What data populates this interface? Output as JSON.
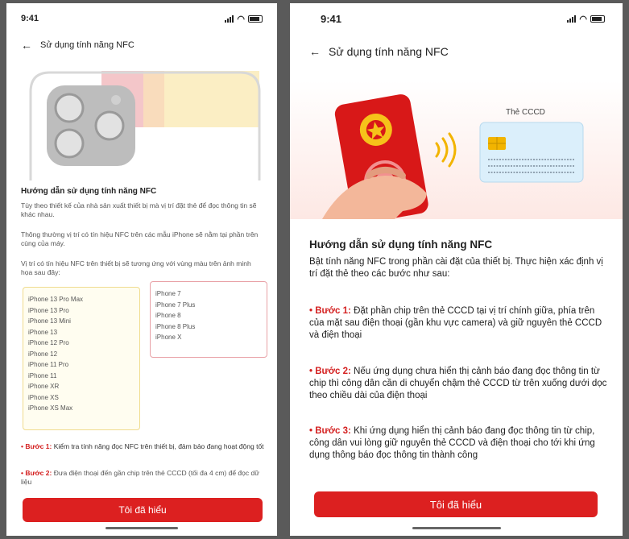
{
  "left": {
    "status_time": "9:41",
    "nav_title": "Sử dụng tính năng NFC",
    "heading": "Hướng dẫn sử dụng tính năng NFC",
    "para1": "Tùy theo thiết kế của nhà sản xuất thiết bị mà vị trí đặt thẻ để đọc thông tin sẽ khác nhau.",
    "para2": "Thông thường vị trí có tín hiệu NFC trên các mẫu iPhone sẽ nằm tại phần trên cùng của máy.",
    "para3": "Vị trí có tín hiệu NFC trên thiết bị sẽ tương ứng với vùng màu trên ảnh minh họa sau đây:",
    "models_yellow": [
      "iPhone 13 Pro Max",
      "iPhone 13 Pro",
      "iPhone 13 Mini",
      "iPhone 13",
      "iPhone 12 Pro",
      "iPhone 12",
      "iPhone 11 Pro",
      "iPhone 11",
      "iPhone XR",
      "iPhone XS",
      "iPhone XS Max"
    ],
    "models_pink": [
      "iPhone 7",
      "iPhone 7 Plus",
      "iPhone 8",
      "iPhone 8 Plus",
      "iPhone X"
    ],
    "step1_label": "• Bước 1:",
    "step1_text": "Kiểm tra tính năng đọc NFC trên thiết bị, đảm bảo đang hoạt động tốt",
    "step2_label": "• Bước 2:",
    "step2_text": "Đưa điện thoại đến gần chip trên thẻ CCCD (tối đa 4 cm) để đọc dữ liệu",
    "button": "Tôi đã hiểu"
  },
  "right": {
    "status_time": "9:41",
    "nav_title": "Sử dụng tính năng NFC",
    "card_label": "Thẻ CCCD",
    "heading": "Hướng dẫn sử dụng tính năng NFC",
    "intro": "Bật tính năng NFC trong phần cài đặt của thiết bị. Thực hiện xác định vị trí đặt thẻ theo các bước như sau:",
    "step1_label": "• Bước 1:",
    "step1_text": "Đặt phần chip trên thẻ CCCD tại vị trí chính giữa, phía trên của mặt sau điện thoại (gần khu vực camera) và giữ nguyên thẻ CCCD và điện thoại",
    "step2_label": "• Bước 2:",
    "step2_text": "Nếu ứng dụng chưa hiển thị cảnh báo đang đọc thông tin từ chip thì công dân cần di chuyển chậm thẻ CCCD từ trên xuống dưới dọc theo chiều dài của điện thoại",
    "step3_label": "• Bước 3:",
    "step3_text": "Khi ứng dụng hiển thị cảnh báo đang đọc thông tin từ chip, công dân vui lòng giữ nguyên thẻ CCCD và điện thoại cho tới khi ứng dụng thông báo đọc thông tin thành công",
    "button": "Tôi đã hiểu"
  },
  "colors": {
    "accent": "#dc2020",
    "yellow_zone": "#fbeec4",
    "pink_zone": "#f4c6c9",
    "orange_zone": "#f9dcbc"
  },
  "icons": [
    "back-arrow-icon",
    "signal-icon",
    "wifi-icon",
    "battery-icon",
    "nfc-wave-icon",
    "chip-icon",
    "emblem-icon"
  ]
}
